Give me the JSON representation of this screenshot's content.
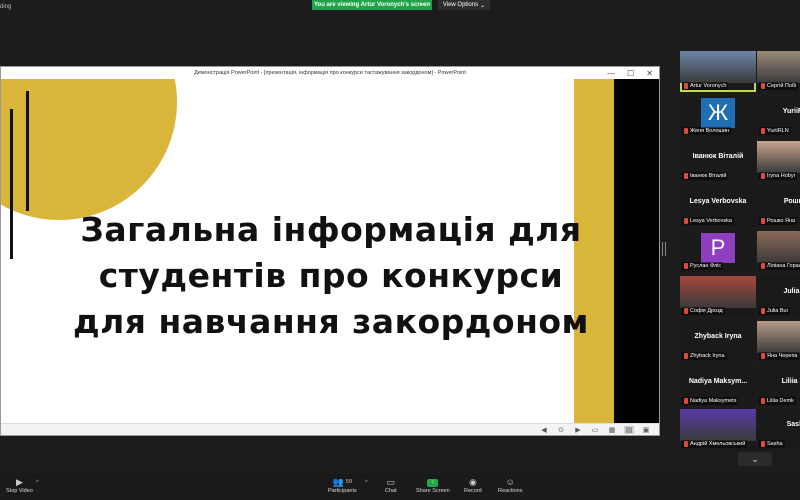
{
  "top": {
    "recording_text": "ding",
    "viewing_banner": "You are viewing Artur Voronych's screen",
    "view_options": "View Options",
    "view_options_chevron": "⌄"
  },
  "ppt": {
    "window_title": "Демонстрація PowerPoint - [презентація, інформація про конкурси тастажування закордоном] - PowerPoint",
    "btn_minimize": "—",
    "btn_maximize": "☐",
    "btn_close": "✕",
    "slide_title": "Загальна інформація для студентів про конкурси для навчання закордоном",
    "accent_color": "#d9b63a"
  },
  "gallery": {
    "tiles": [
      {
        "name": "Artur Voronych",
        "type": "photo",
        "color": "#6b86a8",
        "active": true
      },
      {
        "name": "Сергій Побі",
        "type": "photo",
        "color": "#9a8a7a"
      },
      {
        "name": "Женя Волошин",
        "type": "letter",
        "letter": "Ж",
        "color": "#1f6fb5"
      },
      {
        "name": "YuriiRLN",
        "type": "center",
        "center": "YuriiRL"
      },
      {
        "name": "Іванюк Віталій",
        "type": "center",
        "center": "Іванюк Віталій"
      },
      {
        "name": "Iryna Hobyr",
        "type": "photo",
        "color": "#c9a48c"
      },
      {
        "name": "Lesya Verbovska",
        "type": "center",
        "center": "Lesya Verbovska"
      },
      {
        "name": "Рошко Яна",
        "type": "center",
        "center": "Рошко"
      },
      {
        "name": "Руслан Фліс",
        "type": "letter",
        "letter": "P",
        "color": "#8e3fbf"
      },
      {
        "name": "Ліліана Гораль",
        "type": "photo",
        "color": "#8a6a58"
      },
      {
        "name": "Софія Дрозд",
        "type": "photo",
        "color": "#a4473c"
      },
      {
        "name": "Julia Bui",
        "type": "center",
        "center": "Julia B"
      },
      {
        "name": "Zhyback Iryna",
        "type": "center",
        "center": "Zhyback Iryna"
      },
      {
        "name": "Яна Черепа",
        "type": "photo",
        "color": "#b59a86"
      },
      {
        "name": "Nadiya Maksymets",
        "type": "center",
        "center": "Nadiya Maksym..."
      },
      {
        "name": "Liliia Demk",
        "type": "center",
        "center": "Liliia De"
      },
      {
        "name": "Андрій Хмельовський",
        "type": "photo",
        "color": "#5a3aa8"
      },
      {
        "name": "Sasha",
        "type": "center",
        "center": "Sash"
      }
    ],
    "more_chevron": "⌄"
  },
  "toolbar": {
    "stop_video": "Stop Video",
    "participants": "Participants",
    "participants_count": "59",
    "chat": "Chat",
    "share_screen": "Share Screen",
    "record": "Record",
    "reactions": "Reactions"
  }
}
